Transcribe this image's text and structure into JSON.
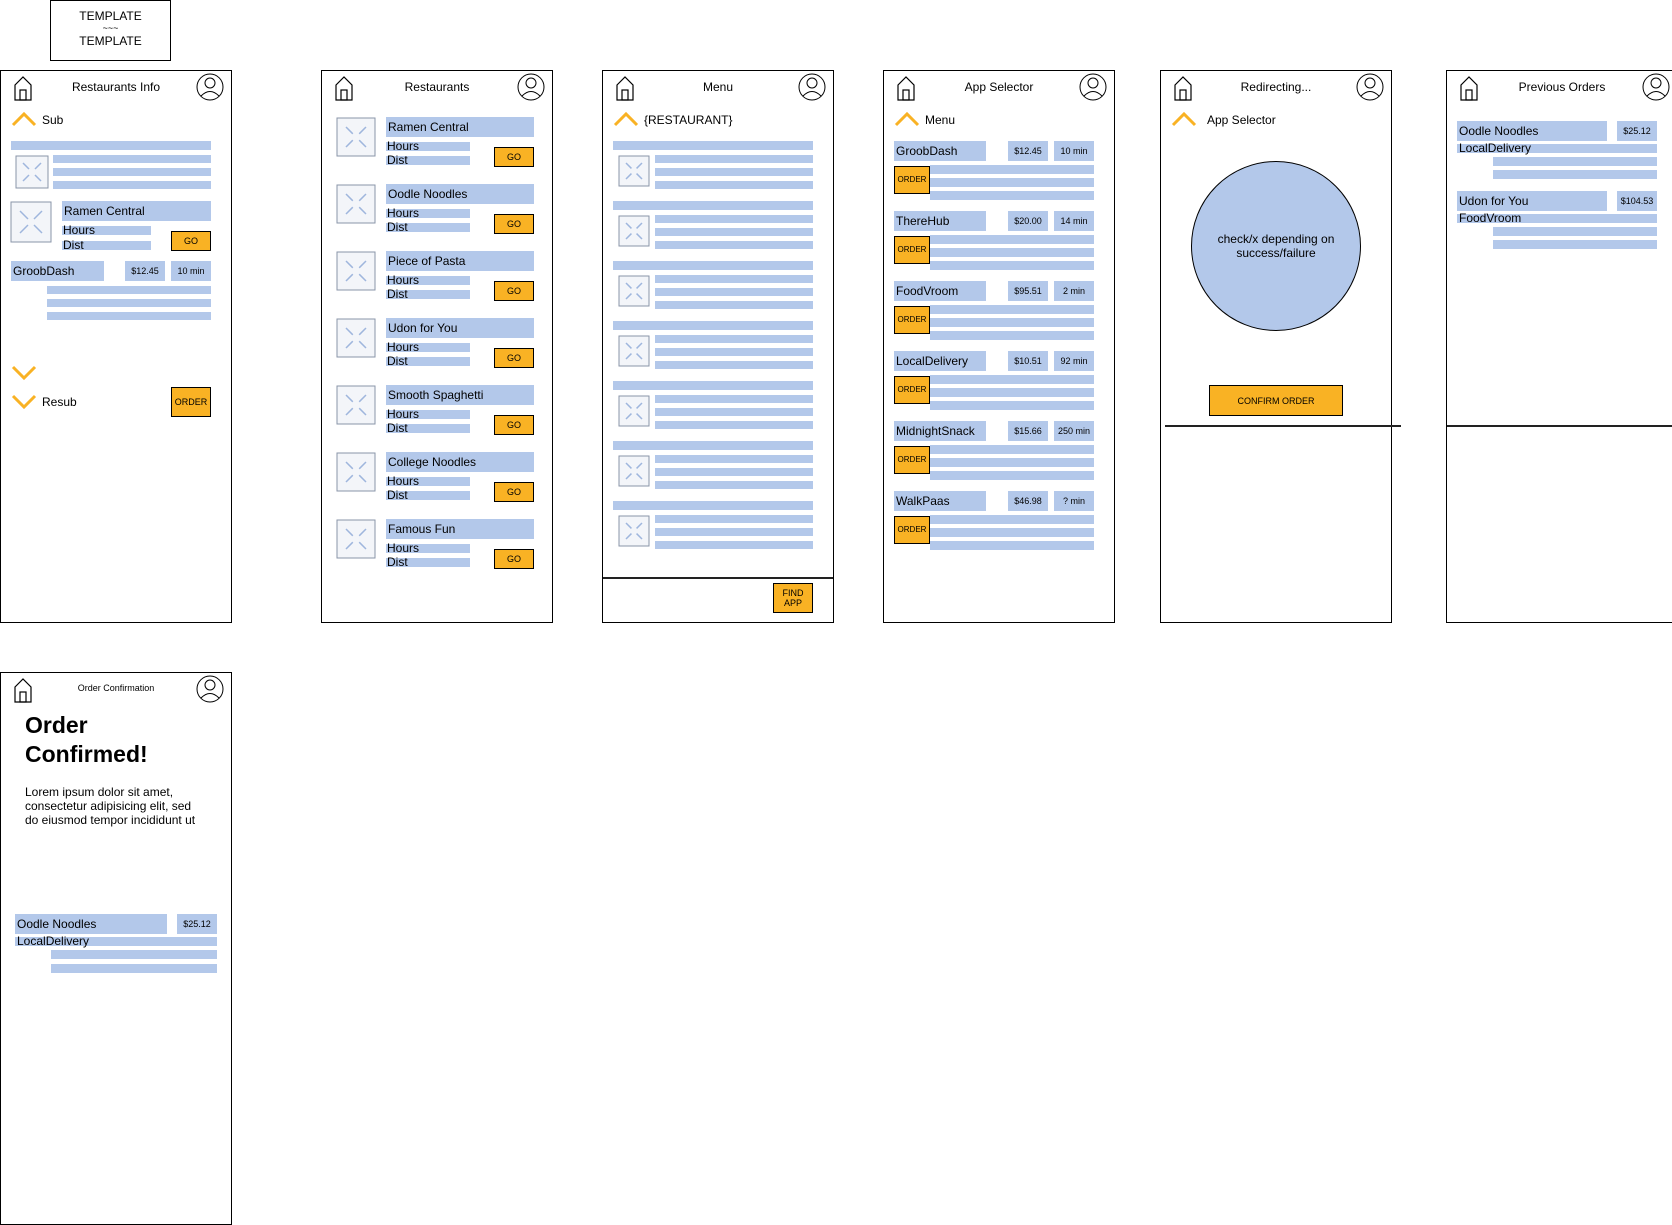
{
  "template_label": {
    "line1": "TEMPLATE",
    "line2": "~~~",
    "line3": "TEMPLATE"
  },
  "colors": {
    "accent": "#f9b224",
    "placeholder": "#b3c8ea",
    "circle": "#b3c8ea"
  },
  "screens": {
    "restaurants_info": {
      "title": "Restaurants Info",
      "sub_label": "Sub",
      "restaurant_name": "Ramen Central",
      "hours_label": "Hours",
      "dist_label": "Dist",
      "go_label": "GO",
      "app_name": "GroobDash",
      "price": "$12.45",
      "time": "10 min",
      "resub_label": "Resub",
      "order_label": "ORDER"
    },
    "restaurants": {
      "title": "Restaurants",
      "hours_label": "Hours",
      "dist_label": "Dist",
      "go_label": "GO",
      "items": [
        {
          "name": "Ramen Central"
        },
        {
          "name": "Oodle Noodles"
        },
        {
          "name": "Piece of Pasta"
        },
        {
          "name": "Udon for You"
        },
        {
          "name": "Smooth Spaghetti"
        },
        {
          "name": "College Noodles"
        },
        {
          "name": "Famous Fun"
        }
      ]
    },
    "menu": {
      "title": "Menu",
      "restaurant_label": "{RESTAURANT}",
      "find_app_line1": "FIND",
      "find_app_line2": "APP"
    },
    "app_selector": {
      "title": "App Selector",
      "back_label": "Menu",
      "order_label": "ORDER",
      "apps": [
        {
          "name": "GroobDash",
          "price": "$12.45",
          "time": "10 min"
        },
        {
          "name": "ThereHub",
          "price": "$20.00",
          "time": "14 min"
        },
        {
          "name": "FoodVroom",
          "price": "$95.51",
          "time": "2 min"
        },
        {
          "name": "LocalDelivery",
          "price": "$10.51",
          "time": "92 min"
        },
        {
          "name": "MidnightSnack",
          "price": "$15.66",
          "time": "250 min"
        },
        {
          "name": "WalkPaas",
          "price": "$46.98",
          "time": "? min"
        }
      ]
    },
    "redirecting": {
      "title": "Redirecting...",
      "back_label": "App Selector",
      "circle_text": "check/x depending on success/failure",
      "confirm_label": "CONFIRM ORDER"
    },
    "previous_orders": {
      "title": "Previous Orders",
      "orders": [
        {
          "restaurant": "Oodle Noodles",
          "price": "$25.12",
          "app": "LocalDelivery"
        },
        {
          "restaurant": "Udon for You",
          "price": "$104.53",
          "app": "FoodVroom"
        }
      ]
    },
    "order_confirmation": {
      "title": "Order Confirmation",
      "heading_line1": "Order",
      "heading_line2": "Confirmed!",
      "body": "Lorem ipsum dolor sit amet, consectetur adipisicing elit, sed do eiusmod tempor incididunt ut",
      "restaurant": "Oodle Noodles",
      "price": "$25.12",
      "app": "LocalDelivery"
    }
  }
}
